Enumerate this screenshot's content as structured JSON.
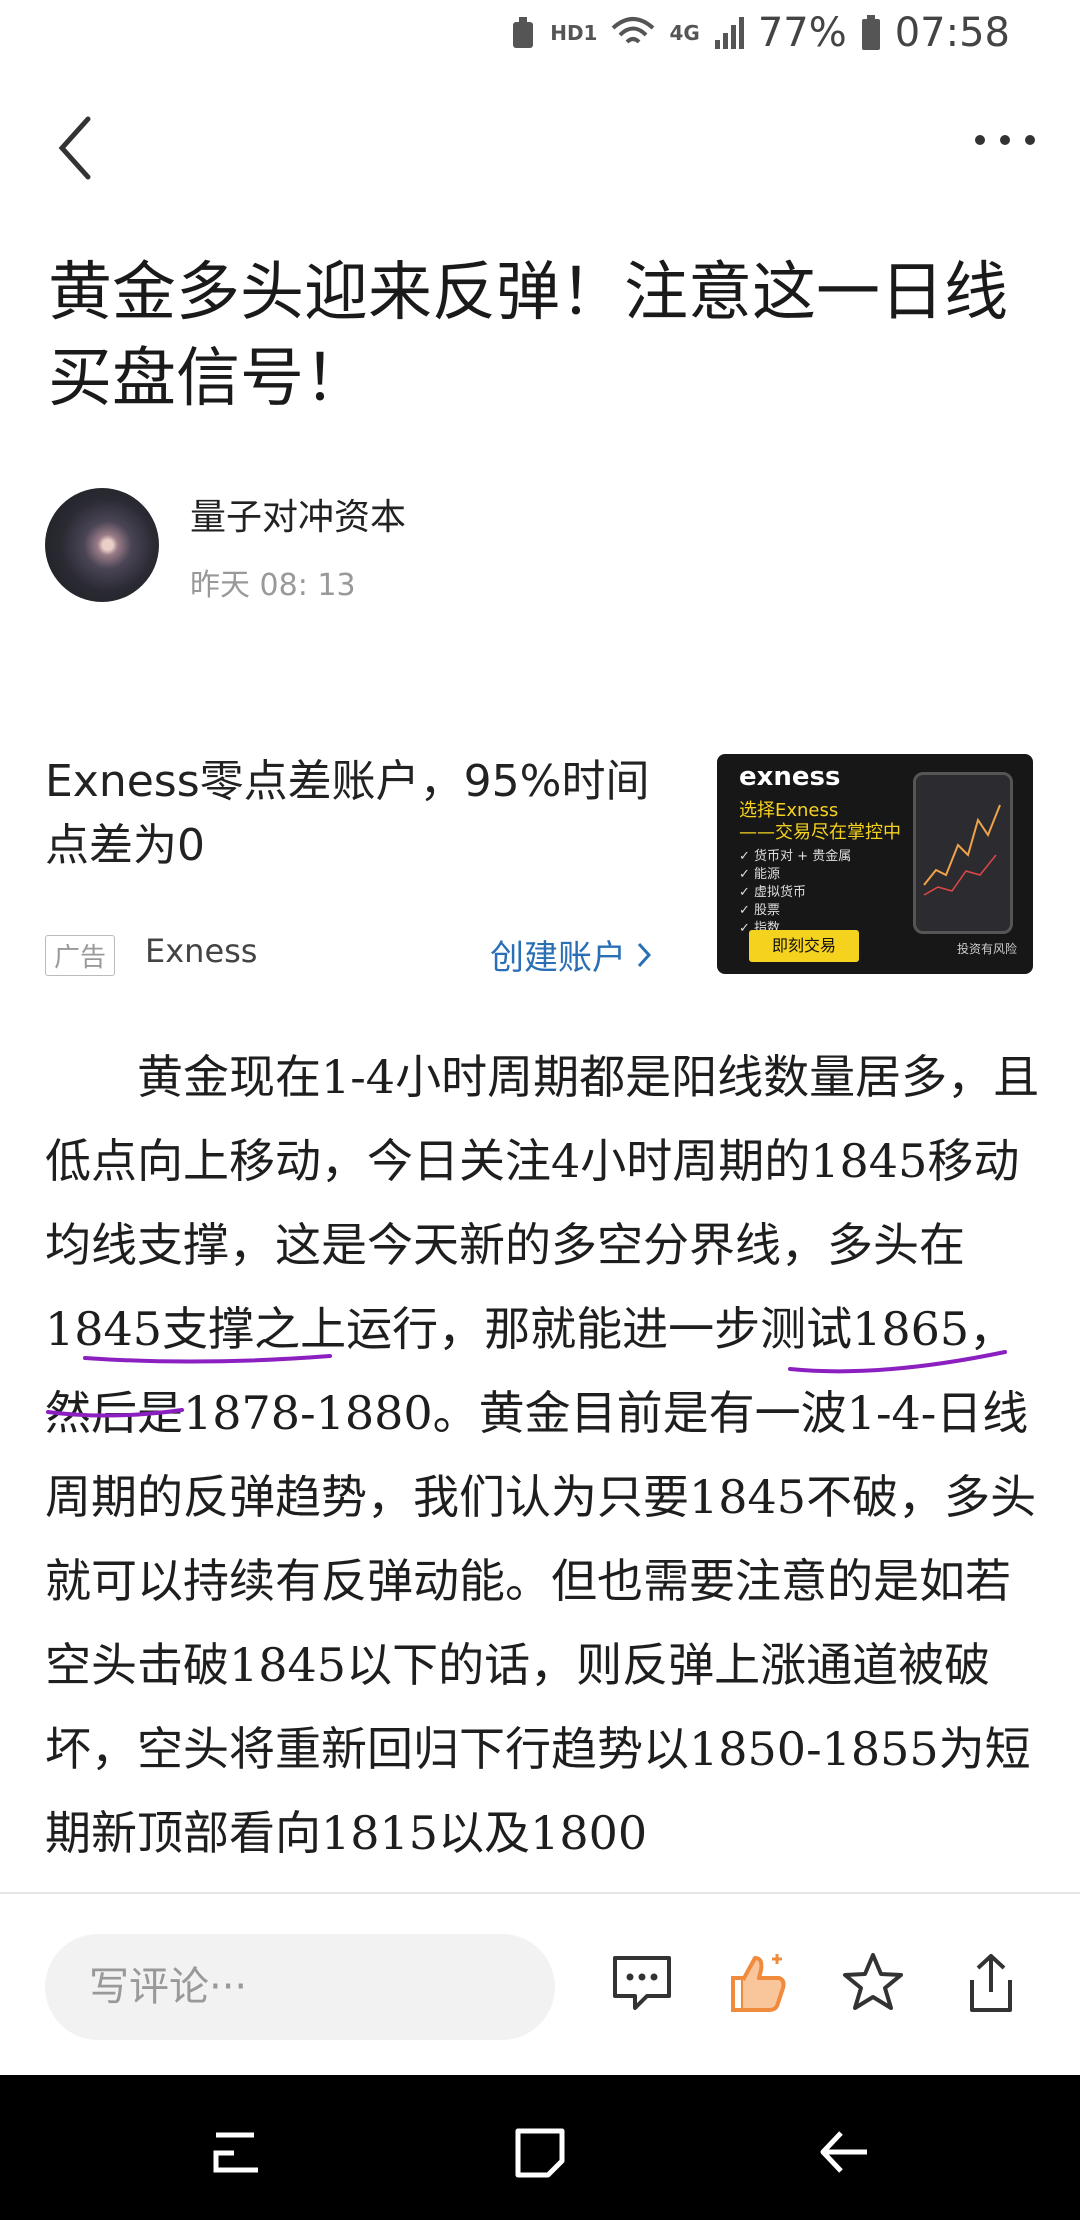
{
  "status_bar": {
    "hd_label": "HD1",
    "network": "4G",
    "battery": "77%",
    "time": "07:58"
  },
  "article": {
    "title": "黄金多头迎来反弹！注意这一日线买盘信号！",
    "author": "量子对冲资本",
    "published": "昨天 08: 13",
    "body": "黄金现在1-4小时周期都是阳线数量居多，且低点向上移动，今日关注4小时周期的1845移动均线支撑，这是今天新的多空分界线，多头在1845支撑之上运行，那就能进一步测试1865，然后是1878-1880。黄金目前是有一波1-4-日线周期的反弹趋势，我们认为只要1845不破，多头就可以持续有反弹动能。但也需要注意的是如若空头击破1845以下的话，则反弹上涨通道被破坏，空头将重新回归下行趋势以1850-1855为短期新顶部看向1815以及1800"
  },
  "ad": {
    "headline": "Exness零点差账户，95%时间点差为0",
    "tag": "广告",
    "brand": "Exness",
    "cta": "创建账户",
    "image": {
      "logo": "exness",
      "line1": "选择Exness",
      "line2": "——交易尽在掌控中",
      "items": [
        "货币对 + 贵金属",
        "能源",
        "虚拟货币",
        "股票",
        "指数"
      ],
      "button": "即刻交易",
      "risk": "投资有风险"
    }
  },
  "bottom_bar": {
    "comment_placeholder": "写评论···"
  },
  "colors": {
    "accent_blue": "#2a6fb5",
    "like_orange": "#f08a3c",
    "annotation_purple": "#8b1fbf"
  }
}
